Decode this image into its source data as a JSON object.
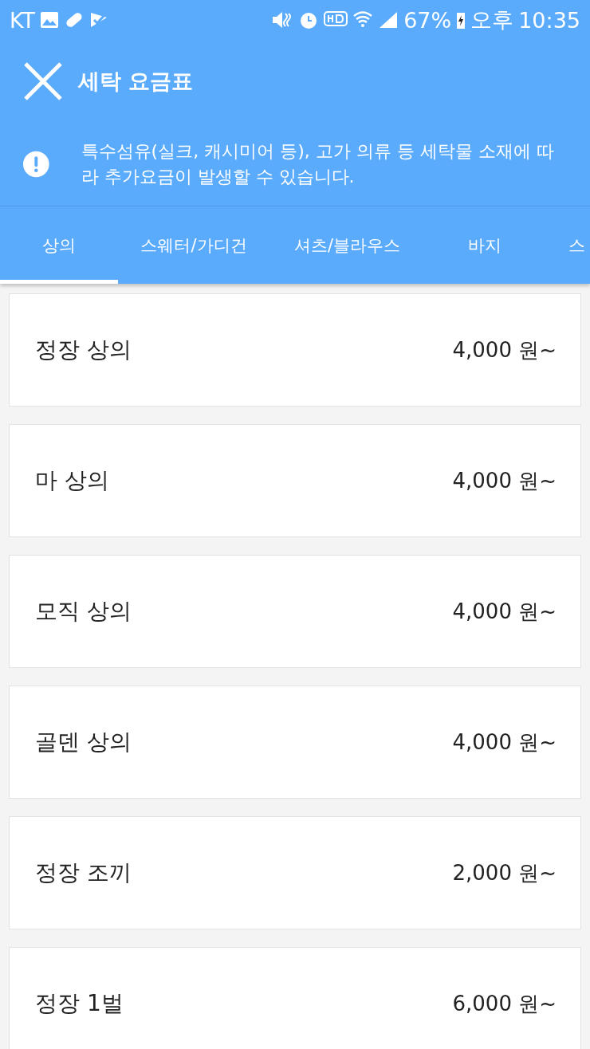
{
  "status_bar": {
    "carrier": "KT",
    "battery": "67%",
    "ampm": "오후",
    "time": "10:35"
  },
  "header": {
    "title": "세탁 요금표",
    "notice": "특수섬유(실크, 캐시미어 등), 고가 의류 등 세탁물 소재에 따라 추가요금이 발생할 수 있습니다."
  },
  "tabs": [
    {
      "label": "상의",
      "selected": true
    },
    {
      "label": "스웨터/가디건",
      "selected": false
    },
    {
      "label": "셔츠/블라우스",
      "selected": false
    },
    {
      "label": "바지",
      "selected": false
    },
    {
      "label": "스",
      "selected": false
    }
  ],
  "items": [
    {
      "name": "정장 상의",
      "price": "4,000 원~"
    },
    {
      "name": "마 상의",
      "price": "4,000 원~"
    },
    {
      "name": "모직 상의",
      "price": "4,000 원~"
    },
    {
      "name": "골덴 상의",
      "price": "4,000 원~"
    },
    {
      "name": "정장 조끼",
      "price": "2,000 원~"
    },
    {
      "name": "정장 1벌",
      "price": "6,000 원~"
    }
  ]
}
